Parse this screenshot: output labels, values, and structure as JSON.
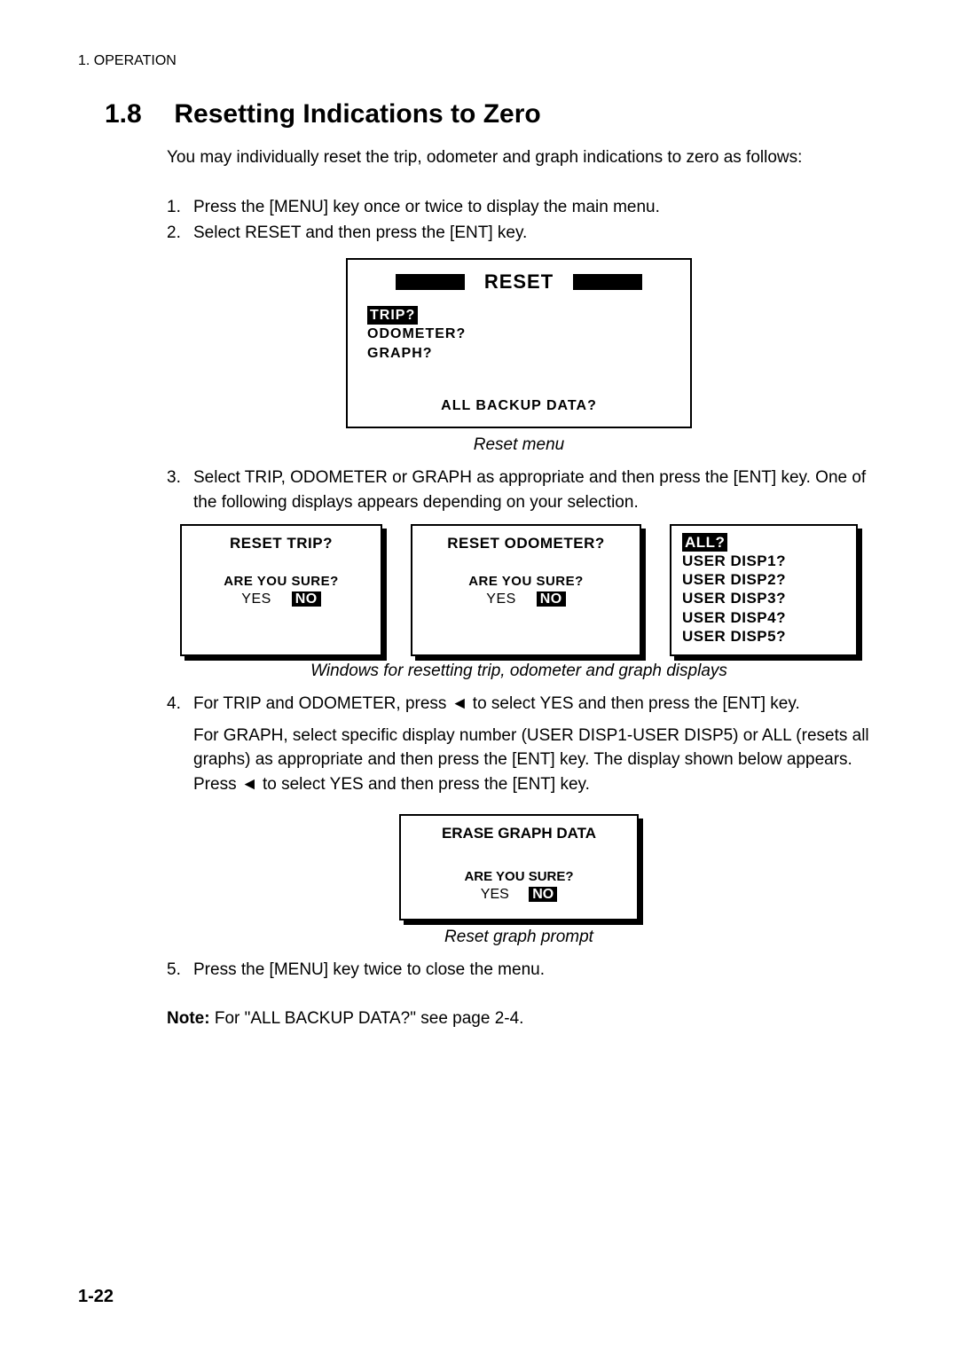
{
  "header": "1. OPERATION",
  "section_number": "1.8",
  "section_title": "Resetting Indications to Zero",
  "intro": "You may individually reset the trip, odometer and graph indications to zero as follows:",
  "steps": {
    "s1": "Press the [MENU] key once or twice to display the main menu.",
    "s2": "Select RESET and then press the [ENT] key.",
    "s3": "Select TRIP, ODOMETER or GRAPH as appropriate and then press the [ENT] key. One of the following displays appears depending on your selection.",
    "s4a": "For TRIP and ODOMETER, press ",
    "s4arrow": "◄",
    "s4b": " to select YES and then press the [ENT] key.",
    "s4c": "For GRAPH, select specific display number (USER DISP1-USER DISP5) or ALL (resets all graphs) as appropriate and then press the [ENT] key. The display shown below appears. Press ",
    "s4d": " to select YES and then press the [ENT] key.",
    "s5": "Press the [MENU] key twice to close the menu."
  },
  "reset_menu": {
    "title": "RESET",
    "items": {
      "trip": "TRIP?",
      "odo": "ODOMETER?",
      "graph": "GRAPH?"
    },
    "backup": "ALL BACKUP DATA?",
    "caption": "Reset menu"
  },
  "dialogs": {
    "trip_title": "RESET TRIP?",
    "odo_title": "RESET ODOMETER?",
    "sure": "ARE YOU SURE?",
    "yes": "YES",
    "no": "NO",
    "caption": "Windows for resetting trip, odometer and graph displays"
  },
  "graph_box": {
    "all": "ALL?",
    "d1": "USER DISP1?",
    "d2": "USER DISP2?",
    "d3": "USER DISP3?",
    "d4": "USER DISP4?",
    "d5": "USER DISP5?"
  },
  "erase": {
    "title": "ERASE GRAPH DATA",
    "sure": "ARE YOU SURE?",
    "yes": "YES",
    "no": "NO",
    "caption": "Reset graph prompt"
  },
  "note_label": "Note:",
  "note_text": " For \"ALL BACKUP DATA?\" see page 2-4.",
  "page_number": "1-22"
}
